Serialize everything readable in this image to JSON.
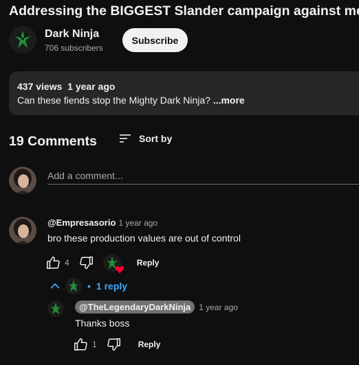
{
  "video": {
    "title": "Addressing the BIGGEST Slander campaign against me"
  },
  "channel": {
    "name": "Dark Ninja",
    "subscribers": "706 subscribers",
    "subscribe_label": "Subscribe"
  },
  "description": {
    "views": "437 views",
    "age": "1 year ago",
    "text": "Can these fiends stop the Mighty Dark Ninja? ",
    "more_label": "...more"
  },
  "comments": {
    "count_label": "19 Comments",
    "sort_label": "Sort by",
    "add_placeholder": "Add a comment...",
    "items": [
      {
        "author": "@Empresasorio",
        "time": "1 year ago",
        "text": "bro these production values are out of control",
        "likes": "4",
        "reply_label": "Reply",
        "replies_toggle": "1 reply",
        "replies": [
          {
            "author": "@TheLegendaryDarkNinja",
            "time": "1 year ago",
            "text": "Thanks boss",
            "likes": "1",
            "reply_label": "Reply"
          }
        ]
      }
    ]
  },
  "colors": {
    "background": "#0f0f0f",
    "text": "#f1f1f1",
    "muted": "#aaaaaa",
    "accent_link": "#3ea6ff",
    "heart": "#ff0033"
  }
}
